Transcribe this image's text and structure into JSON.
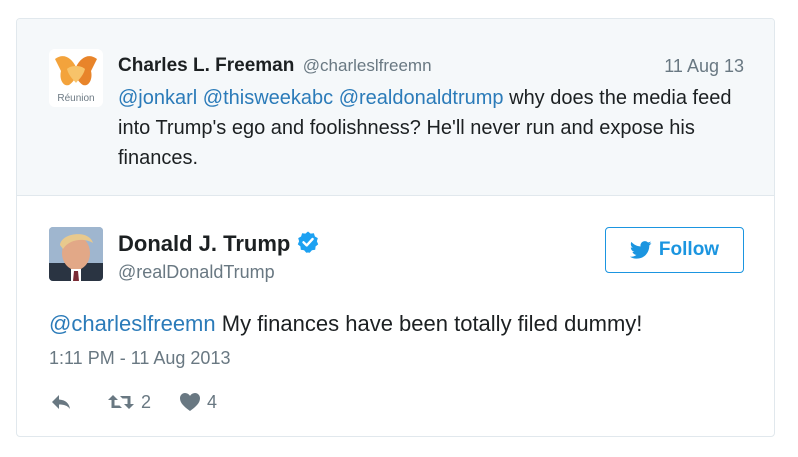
{
  "quoted_tweet": {
    "avatar_caption": "Réunion",
    "name": "Charles L. Freeman",
    "handle": "@charleslfreemn",
    "date": "11 Aug 13",
    "mentions": [
      "@jonkarl",
      "@thisweekabc",
      "@realdonaldtrump"
    ],
    "text": " why does the media feed into Trump's ego and foolishness? He'll never run and expose his finances."
  },
  "tweet": {
    "name": "Donald J. Trump",
    "handle": "@realDonaldTrump",
    "follow_label": "Follow",
    "mention": "@charleslfreemn",
    "text": " My finances have been totally filed dummy!",
    "timestamp": "1:11 PM - 11 Aug 2013",
    "retweet_count": "2",
    "like_count": "4"
  },
  "colors": {
    "link": "#2b7bb9",
    "follow_blue": "#1b95e0",
    "muted": "#697882",
    "parent_bg": "#f5f8fa"
  },
  "icons": {
    "reply": "reply-icon",
    "retweet": "retweet-icon",
    "like": "heart-icon",
    "verified": "verified-badge-icon",
    "twitter": "twitter-bird-icon"
  }
}
